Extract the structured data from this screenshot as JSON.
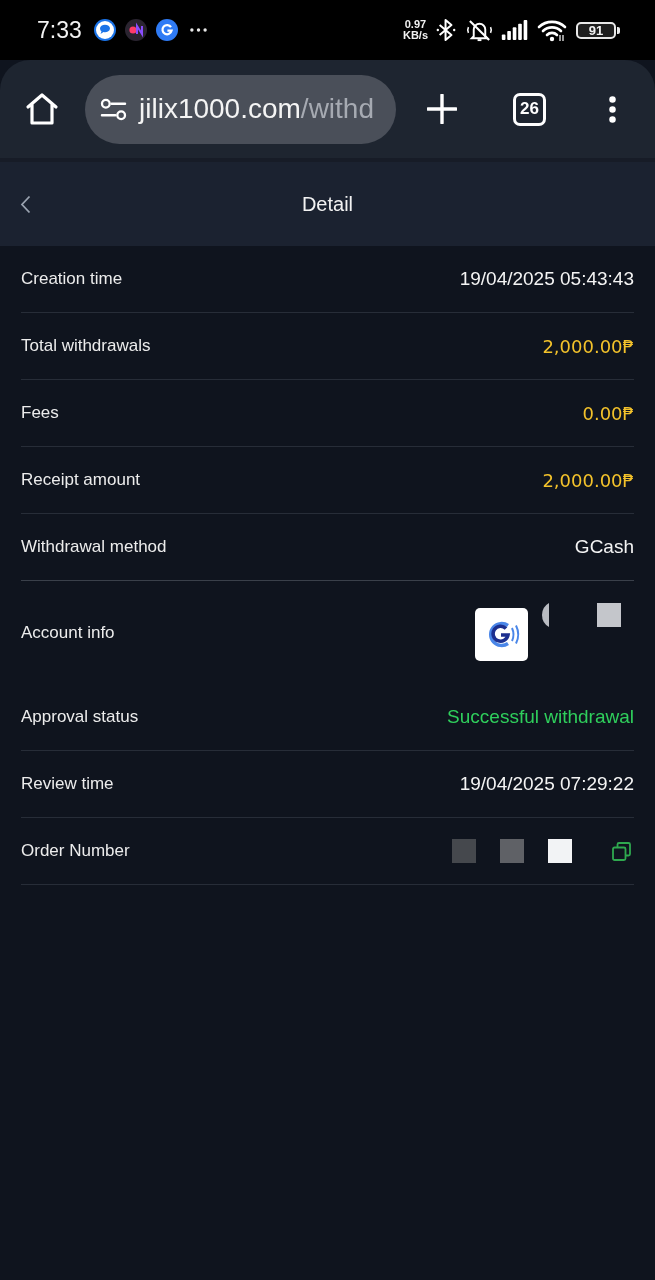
{
  "status_bar": {
    "time": "7:33",
    "network_speed": "0.97",
    "network_speed_unit": "KB/s",
    "battery": "91"
  },
  "browser": {
    "url_host": "jilix1000.com",
    "url_path": "/withd",
    "tab_count": "26"
  },
  "header": {
    "title": "Detail"
  },
  "details": [
    {
      "kind": "text",
      "label": "Creation time",
      "value": "19/04/2025 05:43:43"
    },
    {
      "kind": "amount",
      "label": "Total withdrawals",
      "value": "2,000.00₱"
    },
    {
      "kind": "amount",
      "label": "Fees",
      "value": "0.00₱"
    },
    {
      "kind": "amount",
      "label": "Receipt amount",
      "value": "2,000.00₱"
    },
    {
      "kind": "text",
      "label": "Withdrawal method",
      "value": "GCash"
    },
    {
      "kind": "account",
      "label": "Account info"
    },
    {
      "kind": "status",
      "label": "Approval status",
      "value": "Successful withdrawal"
    },
    {
      "kind": "text",
      "label": "Review time",
      "value": "19/04/2025 07:29:22"
    },
    {
      "kind": "order",
      "label": "Order Number"
    }
  ]
}
